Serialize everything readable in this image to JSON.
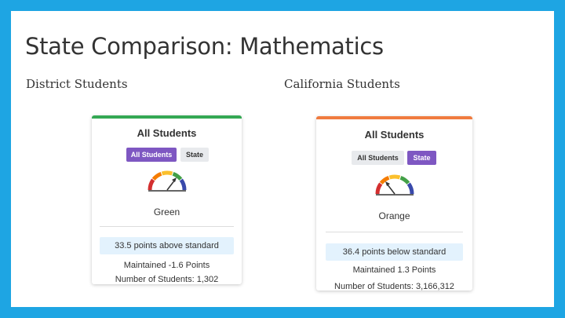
{
  "slide": {
    "title": "State Comparison: Mathematics",
    "left_label": "District Students",
    "right_label": "California Students"
  },
  "cards": [
    {
      "accent_color": "#34a853",
      "title": "All Students",
      "toggle_all": "All Students",
      "toggle_state": "State",
      "active_toggle": "All Students",
      "gauge_level": "Green",
      "color_label": "Green",
      "points": "33.5 points above standard",
      "change": "Maintained -1.6 Points",
      "students": "Number of Students: 1,302"
    },
    {
      "accent_color": "#f07b3f",
      "title": "All Students",
      "toggle_all": "All Students",
      "toggle_state": "State",
      "active_toggle": "State",
      "gauge_level": "Orange",
      "color_label": "Orange",
      "points": "36.4 points below standard",
      "change": "Maintained 1.3 Points",
      "students": "Number of Students: 3,166,312"
    }
  ],
  "gauge_colors": [
    "#d32f2f",
    "#f57c00",
    "#fbc02d",
    "#43a047",
    "#3949ab"
  ]
}
